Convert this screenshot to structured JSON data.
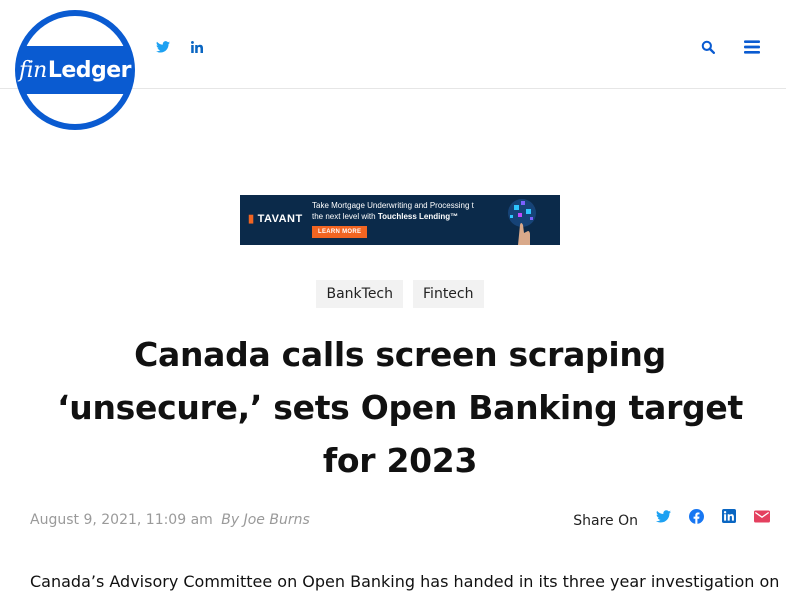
{
  "brand": {
    "logo_fin": "fin",
    "logo_ledger": "Ledger",
    "accent_color": "#0a5bd1"
  },
  "header": {
    "social_icons": [
      "twitter-icon",
      "linkedin-icon"
    ],
    "right_icons": [
      "search-icon",
      "menu-icon"
    ]
  },
  "ad": {
    "brand": "TAVANT",
    "line1": "Take Mortgage Underwriting and Processing to",
    "line2_plain": "the next level with ",
    "line2_bold": "Touchless Lending™",
    "cta": "LEARN MORE"
  },
  "article": {
    "tags": [
      "BankTech",
      "Fintech"
    ],
    "title": "Canada calls screen scraping ‘unsecure,’ sets Open Banking target for 2023",
    "date": "August 9, 2021, 11:09 am",
    "author": "By Joe Burns",
    "share_label": "Share On",
    "share_icons": [
      "twitter-icon",
      "facebook-icon",
      "linkedin-icon",
      "email-icon"
    ],
    "share_colors": {
      "twitter": "#1da1f2",
      "facebook": "#1877f2",
      "linkedin": "#0a66c2",
      "email": "#e4405f"
    },
    "lead": "Canada’s Advisory Committee on Open Banking has handed in its three year investigation on"
  }
}
